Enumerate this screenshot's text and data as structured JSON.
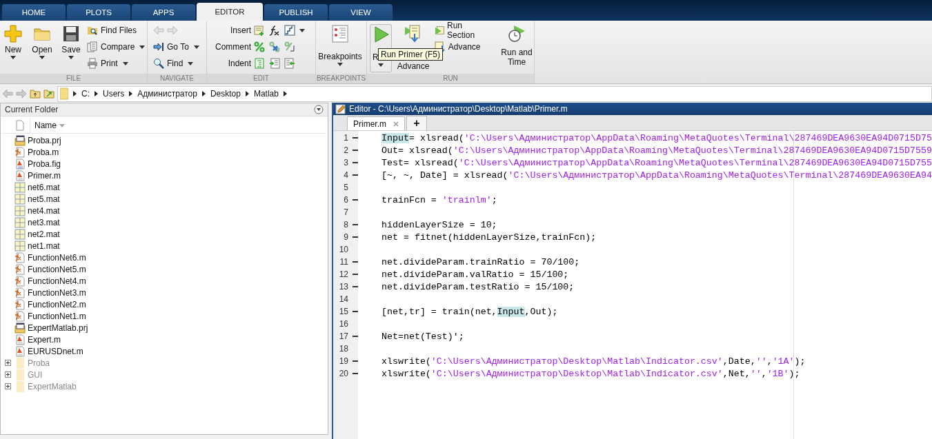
{
  "tabs": [
    {
      "label": "HOME",
      "selected": false
    },
    {
      "label": "PLOTS",
      "selected": false
    },
    {
      "label": "APPS",
      "selected": false
    },
    {
      "label": "EDITOR",
      "selected": true
    },
    {
      "label": "PUBLISH",
      "selected": false
    },
    {
      "label": "VIEW",
      "selected": false
    }
  ],
  "file_group": {
    "title": "FILE",
    "new_button": "New",
    "open_button": "Open",
    "save_button": "Save",
    "find_files": "Find Files",
    "compare": "Compare",
    "print": "Print"
  },
  "navigate_group": {
    "title": "NAVIGATE",
    "back": {
      "disabled": true
    },
    "forward": {
      "disabled": true
    },
    "go_to": "Go To",
    "find": "Find"
  },
  "edit_group": {
    "title": "EDIT",
    "insert": "Insert",
    "comment": "Comment",
    "indent": "Indent"
  },
  "breakpoints_group": {
    "title": "BREAKPOINTS",
    "breakpoints_button": "Breakpoints"
  },
  "run_group": {
    "title": "RUN",
    "run_button": "R",
    "run_and_advance_button": "Advance",
    "run_section": "Run Section",
    "advance": "Advance",
    "run_and_time_button": "Run and Time"
  },
  "tooltip": "Run Primer (F5)",
  "address_bar": {
    "path": [
      "C:",
      "Users",
      "Администратор",
      "Desktop",
      "Matlab"
    ]
  },
  "current_folder": {
    "title": "Current Folder",
    "column": "Name",
    "items": [
      {
        "name": "Proba.prj",
        "kind": "project"
      },
      {
        "name": "Proba.m",
        "kind": "function"
      },
      {
        "name": "Proba.fig",
        "kind": "figure"
      },
      {
        "name": "Primer.m",
        "kind": "script"
      },
      {
        "name": "net6.mat",
        "kind": "data"
      },
      {
        "name": "net5.mat",
        "kind": "data"
      },
      {
        "name": "net4.mat",
        "kind": "data"
      },
      {
        "name": "net3.mat",
        "kind": "data"
      },
      {
        "name": "net2.mat",
        "kind": "data"
      },
      {
        "name": "net1.mat",
        "kind": "data"
      },
      {
        "name": "FunctionNet6.m",
        "kind": "function"
      },
      {
        "name": "FunctionNet5.m",
        "kind": "function"
      },
      {
        "name": "FunctionNet4.m",
        "kind": "function"
      },
      {
        "name": "FunctionNet3.m",
        "kind": "function"
      },
      {
        "name": "FunctionNet2.m",
        "kind": "function"
      },
      {
        "name": "FunctionNet1.m",
        "kind": "function"
      },
      {
        "name": "ExpertMatlab.prj",
        "kind": "project"
      },
      {
        "name": "Expert.m",
        "kind": "script"
      },
      {
        "name": "EURUSDnet.m",
        "kind": "script"
      },
      {
        "name": "Proba",
        "kind": "folder",
        "expanded": false
      },
      {
        "name": "GUI",
        "kind": "folder",
        "expanded": false
      },
      {
        "name": "ExpertMatlab",
        "kind": "folder",
        "expanded": false
      }
    ]
  },
  "editor": {
    "title": "Editor - C:\\Users\\Администратор\\Desktop\\Matlab\\Primer.m",
    "tabs": [
      {
        "label": "Primer.m",
        "selected": true
      }
    ],
    "new_tab": "+",
    "lines": [
      {
        "number": "1",
        "segments": [
          {
            "kind": "highlight",
            "text": "Input"
          },
          {
            "kind": "code",
            "text": "= xlsread("
          },
          {
            "kind": "string",
            "text": "'C:\\Users\\Администратор\\AppData\\Roaming\\MetaQuotes\\Terminal\\287469DEA9630EA94D0715D75"
          }
        ]
      },
      {
        "number": "2",
        "segments": [
          {
            "kind": "code",
            "text": "Out= xlsread("
          },
          {
            "kind": "string",
            "text": "'C:\\Users\\Администратор\\AppData\\Roaming\\MetaQuotes\\Terminal\\287469DEA9630EA94D0715D7559"
          }
        ]
      },
      {
        "number": "3",
        "segments": [
          {
            "kind": "code",
            "text": "Test= xlsread("
          },
          {
            "kind": "string",
            "text": "'C:\\Users\\Администратор\\AppData\\Roaming\\MetaQuotes\\Terminal\\287469DEA9630EA94D0715D755"
          }
        ]
      },
      {
        "number": "4",
        "segments": [
          {
            "kind": "code",
            "text": "[~, ~, Date] = xlsread("
          },
          {
            "kind": "string",
            "text": "'C:\\Users\\Администратор\\AppData\\Roaming\\MetaQuotes\\Terminal\\287469DEA9630EA94"
          }
        ]
      },
      {
        "number": "5"
      },
      {
        "number": "6",
        "segments": [
          {
            "kind": "code",
            "text": "trainFcn = "
          },
          {
            "kind": "string",
            "text": "'trainlm'"
          },
          {
            "kind": "code",
            "text": ";"
          }
        ]
      },
      {
        "number": "7"
      },
      {
        "number": "8",
        "segments": [
          {
            "kind": "code",
            "text": "hiddenLayerSize = 10;"
          }
        ]
      },
      {
        "number": "9",
        "segments": [
          {
            "kind": "code",
            "text": "net = fitnet(hiddenLayerSize,trainFcn);"
          }
        ]
      },
      {
        "number": "10"
      },
      {
        "number": "11",
        "segments": [
          {
            "kind": "code",
            "text": "net.divideParam.trainRatio = 70/100;"
          }
        ]
      },
      {
        "number": "12",
        "segments": [
          {
            "kind": "code",
            "text": "net.divideParam.valRatio = 15/100;"
          }
        ]
      },
      {
        "number": "13",
        "segments": [
          {
            "kind": "code",
            "text": "net.divideParam.testRatio = 15/100;"
          }
        ]
      },
      {
        "number": "14"
      },
      {
        "number": "15",
        "segments": [
          {
            "kind": "code",
            "text": "[net,tr] = train(net,"
          },
          {
            "kind": "highlight",
            "text": "Input"
          },
          {
            "kind": "code",
            "text": ",Out);"
          }
        ]
      },
      {
        "number": "16"
      },
      {
        "number": "17",
        "segments": [
          {
            "kind": "code",
            "text": "Net=net(Test)';"
          }
        ]
      },
      {
        "number": "18"
      },
      {
        "number": "19",
        "segments": [
          {
            "kind": "code",
            "text": "xlswrite("
          },
          {
            "kind": "string",
            "text": "'C:\\Users\\Администратор\\Desktop\\Matlab\\Indicator.csv'"
          },
          {
            "kind": "code",
            "text": ",Date,"
          },
          {
            "kind": "string",
            "text": "''"
          },
          {
            "kind": "code",
            "text": ","
          },
          {
            "kind": "string",
            "text": "'1A'"
          },
          {
            "kind": "code",
            "text": ");"
          }
        ]
      },
      {
        "number": "20",
        "segments": [
          {
            "kind": "code",
            "text": "xlswrite("
          },
          {
            "kind": "string",
            "text": "'C:\\Users\\Администратор\\Desktop\\Matlab\\Indicator.csv'"
          },
          {
            "kind": "code",
            "text": ",Net,"
          },
          {
            "kind": "string",
            "text": "''"
          },
          {
            "kind": "code",
            "text": ","
          },
          {
            "kind": "string",
            "text": "'1B'"
          },
          {
            "kind": "code",
            "text": ");"
          }
        ]
      }
    ]
  }
}
